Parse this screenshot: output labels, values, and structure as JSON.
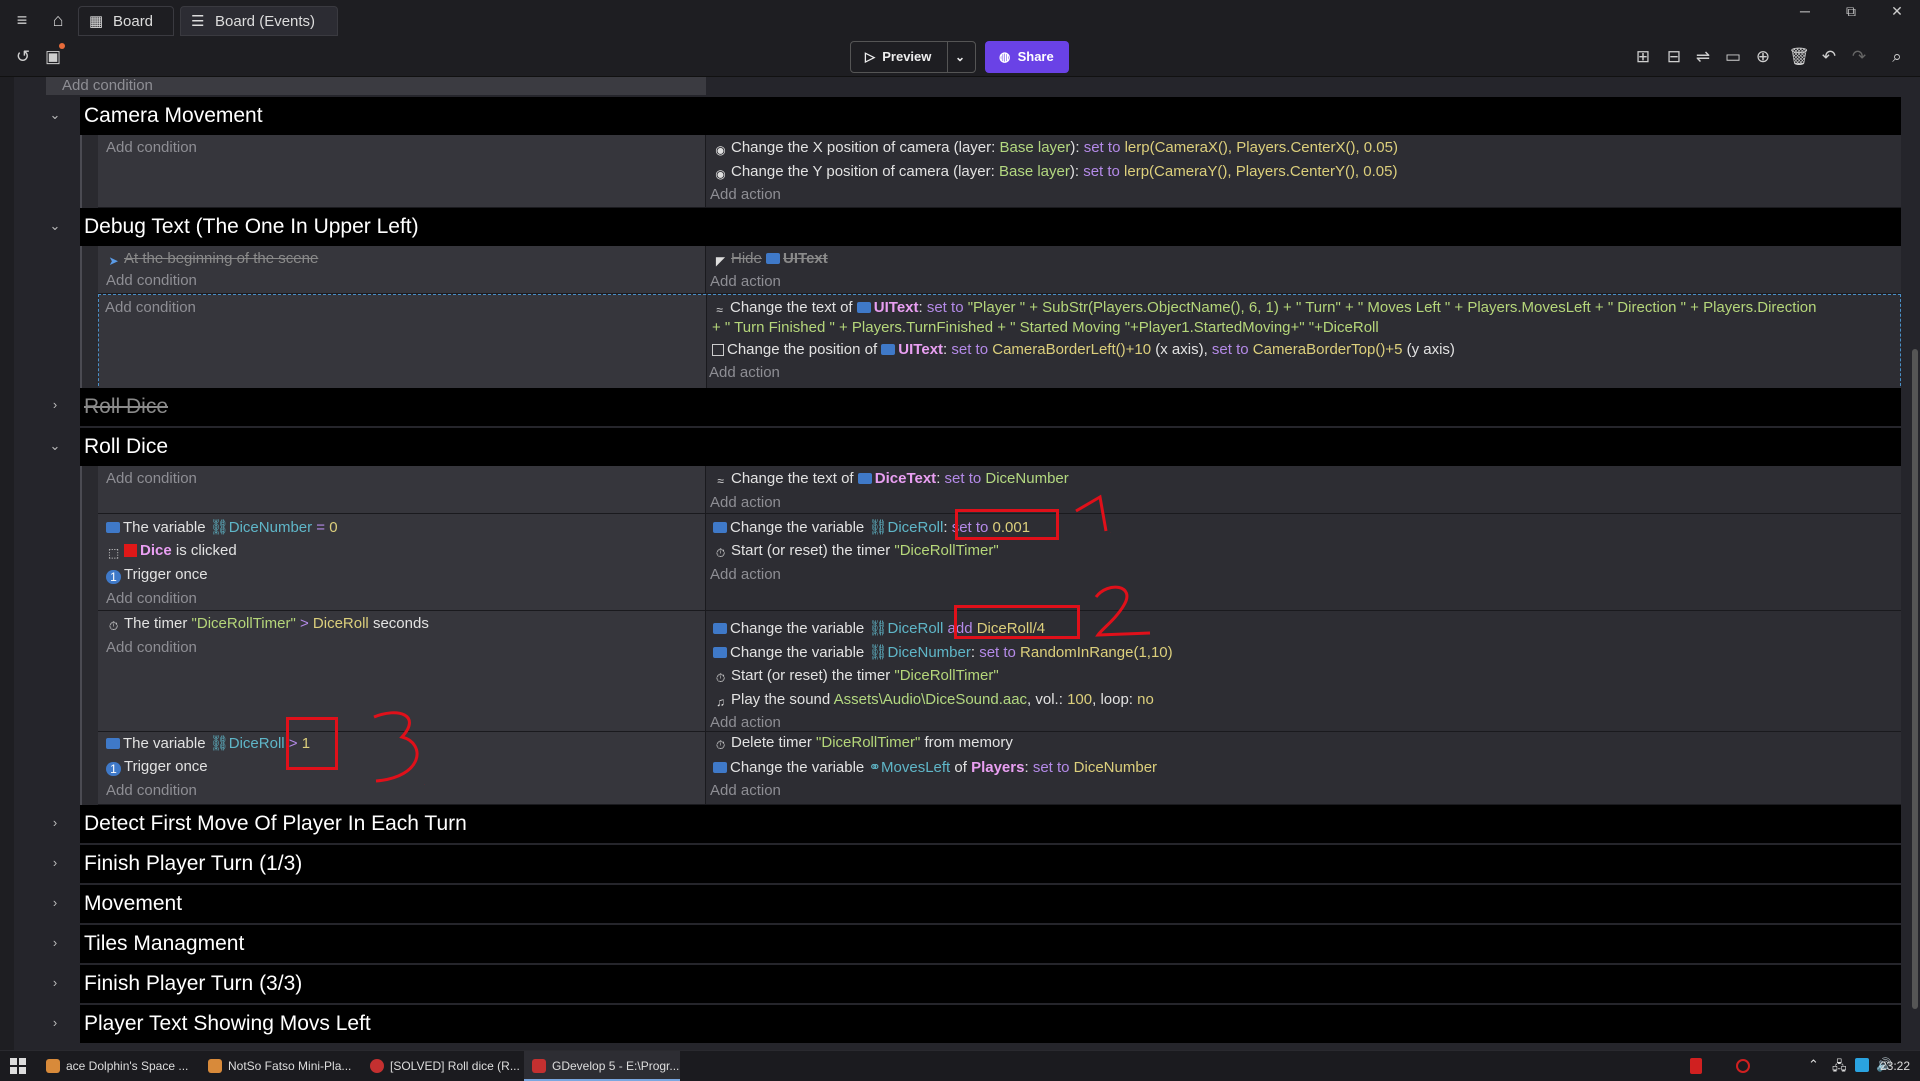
{
  "tabs": [
    {
      "label": "Board"
    },
    {
      "label": "Board (Events)"
    }
  ],
  "window_buttons": {
    "minimize": "─",
    "restore": "⧉",
    "close": "✕"
  },
  "toolbar": {
    "preview_label": "Preview",
    "share_label": "Share"
  },
  "accent_color": "#6a42e6",
  "top_add_condition": "Add condition",
  "groups": [
    {
      "label": "Camera Movement"
    },
    {
      "label": "Debug Text (The One In Upper Left)"
    },
    {
      "label": "Roll Dice"
    },
    {
      "label": "Roll Dice"
    },
    {
      "label": "Detect First Move Of Player In Each Turn"
    },
    {
      "label": "Finish Player Turn (1/3)"
    },
    {
      "label": "Movement"
    },
    {
      "label": "Tiles Managment"
    },
    {
      "label": "Finish Player Turn (3/3)"
    },
    {
      "label": "Player Text Showing Movs Left"
    }
  ],
  "common": {
    "add_condition": "Add condition",
    "add_action": "Add action"
  },
  "camera": {
    "a1": {
      "t1": "Change the X position of camera",
      "t2": "(layer:",
      "layer": "Base layer",
      "t3": "):",
      "kw": "set to",
      "expr": "lerp(CameraX(), Players.CenterX(), 0.05)"
    },
    "a2": {
      "t1": "Change the Y position of camera",
      "t2": "(layer:",
      "layer": "Base layer",
      "t3": "):",
      "kw": "set to",
      "expr": "lerp(CameraY(), Players.CenterY(), 0.05)"
    }
  },
  "debug": {
    "c1": "At the beginning of the scene",
    "a1": {
      "t1": "Hide",
      "obj": "UIText"
    },
    "a2": {
      "t1": "Change the text of",
      "obj": "UIText",
      "t2": ":",
      "kw": "set to",
      "expr1": "\"Player \" + SubStr(Players.ObjectName(), 6, 1) + \" Turn\" + \" Moves Left \" + Players.MovesLeft + \" Direction \" + Players.Direction",
      "expr2": "+ \" Turn Finished \" + Players.TurnFinished + \" Started Moving \"+Player1.StartedMoving+\" \"+DiceRoll"
    },
    "a3": {
      "t1": "Change the position of",
      "obj": "UIText",
      "t2": ":",
      "kw1": "set to",
      "e1": "CameraBorderLeft()+10",
      "t3": "(x axis),",
      "kw2": "set to",
      "e2": "CameraBorderTop()+5",
      "t4": "(y axis)"
    }
  },
  "roll": {
    "e1a1": {
      "t1": "Change the text of",
      "obj": "DiceText",
      "t2": ":",
      "kw": "set to",
      "expr": "DiceNumber"
    },
    "e2c1": {
      "t1": "The variable",
      "var": "DiceNumber",
      "op": "=",
      "val": "0"
    },
    "e2c2": {
      "obj": "Dice",
      "t1": "is clicked"
    },
    "e2c3": "Trigger once",
    "e2a1": {
      "t1": "Change the variable",
      "var": "DiceRoll",
      "t2": ":",
      "kw": "set to",
      "val": "0.001"
    },
    "e2a2": {
      "t1": "Start (or reset) the timer",
      "str": "\"DiceRollTimer\""
    },
    "e3c1": {
      "t1": "The timer",
      "str": "\"DiceRollTimer\"",
      "op": ">",
      "var": "DiceRoll",
      "t2": "seconds"
    },
    "e3a1": {
      "t1": "Change the variable",
      "var": "DiceRoll",
      "kw": "add",
      "val": "DiceRoll/4"
    },
    "e3a2": {
      "t1": "Change the variable",
      "var": "DiceNumber",
      "t2": ":",
      "kw": "set to",
      "val": "RandomInRange(1,10)"
    },
    "e3a3": {
      "t1": "Start (or reset) the timer",
      "str": "\"DiceRollTimer\""
    },
    "e3a4": {
      "t1": "Play the sound",
      "file": "Assets\\Audio\\DiceSound.aac",
      "t2": ", vol.:",
      "vol": "100",
      "t3": ", loop:",
      "loop": "no"
    },
    "e4c1": {
      "t1": "The variable",
      "var": "DiceRoll",
      "op": ">",
      "val": "1"
    },
    "e4c2": "Trigger once",
    "e4a1": {
      "t1": "Delete timer",
      "str": "\"DiceRollTimer\"",
      "t2": "from memory"
    },
    "e4a2": {
      "t1": "Change the variable",
      "var": "MovesLeft",
      "t2": "of",
      "obj": "Players",
      "t3": ":",
      "kw": "set to",
      "val": "DiceNumber"
    }
  },
  "annotations": {
    "n1": "1",
    "n2": "2",
    "n3": "3",
    "color": "#e0101a"
  },
  "taskbar": {
    "items": [
      {
        "label": "ace Dolphin's Space ..."
      },
      {
        "label": "NotSo Fatso Mini-Pla..."
      },
      {
        "label": "[SOLVED] Roll dice (R..."
      },
      {
        "label": "GDevelop 5 - E:\\Progr..."
      }
    ],
    "clock": "23:22"
  }
}
